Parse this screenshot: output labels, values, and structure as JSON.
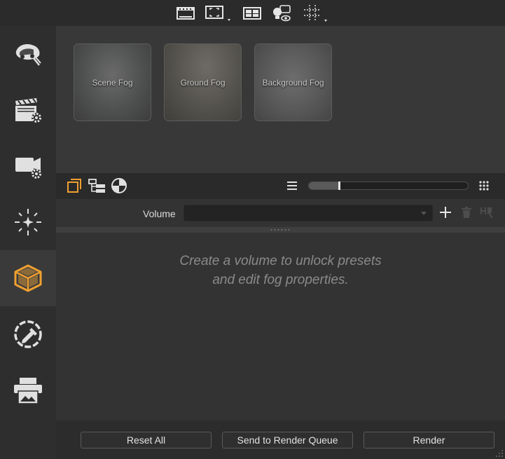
{
  "toolbar": {
    "icons": [
      "film-frame-icon",
      "fullscreen-frame-icon",
      "layout-grid-icon",
      "light-visibility-icon",
      "guides-grid-icon"
    ]
  },
  "sidebar": {
    "items": [
      {
        "name": "scene-car-icon",
        "active": false
      },
      {
        "name": "clapperboard-settings-icon",
        "active": false
      },
      {
        "name": "camera-settings-icon",
        "active": false
      },
      {
        "name": "light-burst-icon",
        "active": false
      },
      {
        "name": "volume-box-icon",
        "active": true
      },
      {
        "name": "color-picker-icon",
        "active": false
      },
      {
        "name": "print-image-icon",
        "active": false
      }
    ]
  },
  "presets": [
    {
      "label": "Scene Fog"
    },
    {
      "label": "Ground Fog"
    },
    {
      "label": "Background Fog"
    }
  ],
  "subbar": {
    "slider_value": 0.19
  },
  "volume": {
    "label": "Volume",
    "selected": ""
  },
  "empty_message": {
    "line1": "Create a volume to unlock presets",
    "line2": "and edit fog properties."
  },
  "bottom": {
    "reset_label": "Reset All",
    "queue_label": "Send to Render Queue",
    "render_label": "Render"
  },
  "colors": {
    "accent": "#f0a030",
    "background": "#2c2c2c",
    "panel": "#383838"
  }
}
